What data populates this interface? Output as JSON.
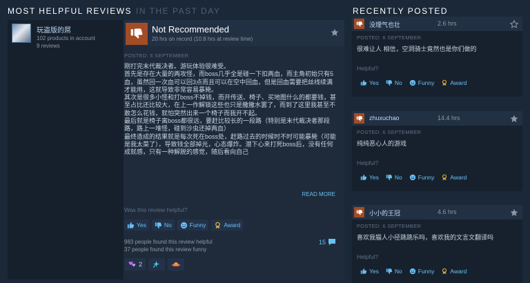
{
  "header": {
    "title": "MOST HELPFUL REVIEWS",
    "subtitle": "IN THE PAST DAY",
    "recent_title": "RECENTLY POSTED"
  },
  "author": {
    "name": "玩盗版的屌",
    "products": "102 products in account",
    "reviews": "9 reviews"
  },
  "review": {
    "verdict": "Not Recommended",
    "hours": "20 hrs on record (10.8 hrs at review time)",
    "posted": "POSTED: 6 SEPTEMBER",
    "body": "刚打完末代裁决者。游玩体验很难受。\n首先是存在大量的两攻怪，而boss几乎全是碰一下扣两血，而主角初始只有5血，虽然回一次血可以回3点而且可以在空中回血，但是回血需要把丝线续满才能用，这就导致非常容易暴毙。\n其次是很多小怪和打boss不掉钱，而开传送、椅子、买地图什么的都要钱，甚至占比还比较大，在上一作解锁这些也只是撒撒水罢了，而到了这里我甚至不敢怎么花钱，就怕突然出来一个椅子而我开不起。\n最后就是椅子离boss都很远，要赶比较长的一段路（特别是末代裁决者那段路，路上一堆怪，碰到沙虫还掉两血）\n最终造成的结果就是每次死在boss处，赶路过去的时候时不时可能暴毙（可能是我太菜了），导致钱全部掉光，心态爆炸。潜下心来打死boss后，没有任何成就感，只有一种解脱的感觉，随后看向自己",
    "read_more": "READ MORE",
    "helpful_question": "Was this review helpful?",
    "buttons": {
      "yes": "Yes",
      "no": "No",
      "funny": "Funny",
      "award": "Award"
    },
    "found_helpful": "983 people found this review helpful",
    "found_funny": "37 people found this review funny",
    "comment_count": "15",
    "award_count": "2"
  },
  "recent": [
    {
      "user": "没理气也壮",
      "hours": "2.6 hrs",
      "posted": "POSTED: 6 SEPTEMBER",
      "text": "很难让人 相信，空洞骑士竟然也是你们做的",
      "helpful_question": "Helpful?",
      "buttons": {
        "yes": "Yes",
        "no": "No",
        "funny": "Funny",
        "award": "Award"
      }
    },
    {
      "user": "zhuxuchao",
      "hours": "14.4 hrs",
      "posted": "POSTED: 6 SEPTEMBER",
      "text": "纯纯恶心人的游戏",
      "helpful_question": "Helpful?",
      "buttons": {
        "yes": "Yes",
        "no": "No",
        "funny": "Funny",
        "award": "Award"
      }
    },
    {
      "user": "小小的王冠",
      "hours": "4.6 hrs",
      "posted": "POSTED: 6 SEPTEMBER",
      "text": "喜欢我猫人小径跳跳乐吗，喜欢我的文言文翻译吗",
      "helpful_question": "Helpful?",
      "buttons": {
        "yes": "Yes",
        "no": "No",
        "funny": "Funny",
        "award": "Award"
      }
    }
  ],
  "colors": {
    "background": "#1b2838",
    "panel": "#16202d",
    "not_recommended": "#a34c25",
    "link": "#67c1f5",
    "award": "#e6b23a"
  },
  "icons": [
    "thumbs-down-icon",
    "thumbs-up-icon",
    "star-icon",
    "funny-icon",
    "award-icon",
    "comment-icon"
  ]
}
